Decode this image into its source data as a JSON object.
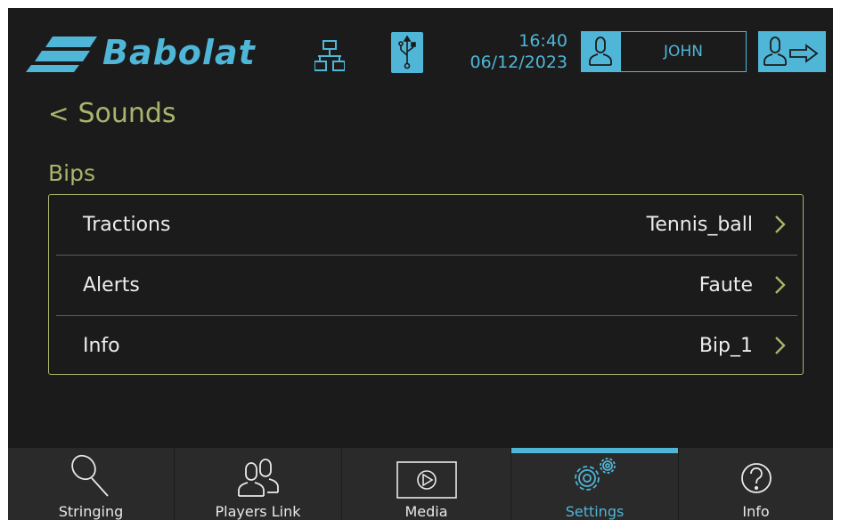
{
  "header": {
    "brand": "Babolat",
    "time": "16:40",
    "date": "06/12/2023",
    "user_name": "JOHN",
    "icons": [
      "babolat-logo",
      "network-icon",
      "usb-icon",
      "user-icon",
      "logout-icon"
    ]
  },
  "page": {
    "back_chevron": "<",
    "title": "Sounds"
  },
  "section": {
    "title": "Bips",
    "rows": [
      {
        "label": "Tractions",
        "value": "Tennis_ball"
      },
      {
        "label": "Alerts",
        "value": "Faute"
      },
      {
        "label": "Info",
        "value": "Bip_1"
      }
    ]
  },
  "tabs": [
    {
      "label": "Stringing",
      "icon": "racket-icon",
      "active": false
    },
    {
      "label": "Players Link",
      "icon": "players-icon",
      "active": false
    },
    {
      "label": "Media",
      "icon": "play-icon",
      "active": false
    },
    {
      "label": "Settings",
      "icon": "gears-icon",
      "active": true
    },
    {
      "label": "Info",
      "icon": "question-icon",
      "active": false
    }
  ],
  "colors": {
    "accent_blue": "#4fb6d8",
    "accent_olive": "#a8b56c",
    "background": "#1b1b1b",
    "tabbar": "#2a2a2a"
  }
}
